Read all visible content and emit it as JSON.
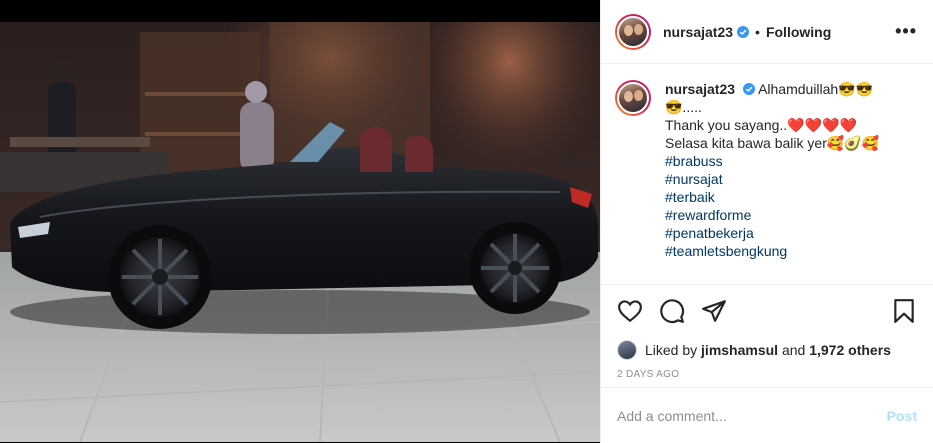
{
  "header": {
    "username": "nursajat23",
    "dot": "•",
    "follow_status": "Following",
    "more_label": "•••"
  },
  "caption": {
    "username": "nursajat23",
    "text_line1": "Alhamduillah😎😎",
    "text_line2": "😎.....",
    "text_line3": "Thank you sayang..❤️❤️❤️❤️",
    "text_line4": "Selasa kita bawa balik yer🥰🥑🥰",
    "hashtags": [
      "#brabuss",
      "#nursajat",
      "#terbaik",
      "#rewardforme",
      "#penatbekerja",
      "#teamletsbengkung"
    ]
  },
  "icons": {
    "like": "heart-icon",
    "comment": "comment-icon",
    "share": "share-icon",
    "save": "bookmark-icon",
    "verified": "verified-badge-icon"
  },
  "likes": {
    "prefix": "Liked by",
    "user": "jimshamsul",
    "and": "and",
    "others": "1,972 others"
  },
  "timestamp": "2 DAYS AGO",
  "comment_box": {
    "placeholder": "Add a comment...",
    "post_label": "Post"
  },
  "colors": {
    "verified": "#3897f0",
    "hashtag": "#00376b",
    "post_disabled": "#b2dffc"
  }
}
